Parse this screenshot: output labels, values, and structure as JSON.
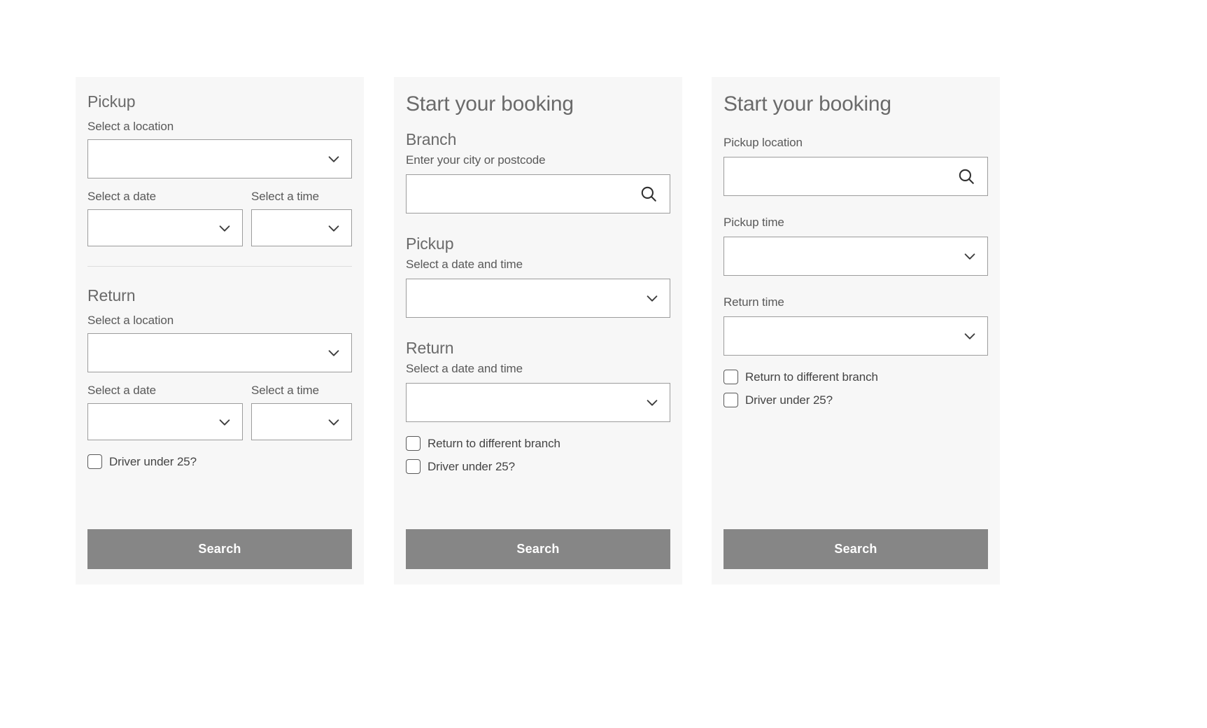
{
  "theme": {
    "page_background": "#ffffff",
    "panel_background": "#f7f7f7",
    "input_background": "#ffffff",
    "input_border": "#9c9c9c",
    "divider": "#dedede",
    "heading_text": "#6a6a6a",
    "label_text": "#595959",
    "button_background": "#868686",
    "button_text": "#ffffff"
  },
  "panels": [
    {
      "id": "panel-1",
      "variant": "pickup-return-split",
      "title": null,
      "sections": [
        {
          "heading": "Pickup",
          "location_label": "Select a location",
          "location_value": "",
          "location_placeholder": "",
          "date_label": "Select a date",
          "date_value": "",
          "date_placeholder": "",
          "time_label": "Select a time",
          "time_value": "",
          "time_placeholder": ""
        },
        {
          "heading": "Return",
          "location_label": "Select a location",
          "location_value": "",
          "location_placeholder": "",
          "date_label": "Select a date",
          "date_value": "",
          "date_placeholder": "",
          "time_label": "Select a time",
          "time_value": "",
          "time_placeholder": ""
        }
      ],
      "checkboxes": [
        {
          "label": "Driver under 25?",
          "checked": false
        }
      ],
      "submit_label": "Search",
      "icons": {
        "dropdown": "chevron-down-icon"
      }
    },
    {
      "id": "panel-2",
      "variant": "branch-search",
      "title": "Start your booking",
      "branch": {
        "heading": "Branch",
        "label": "Enter your city or postcode",
        "value": "",
        "placeholder": ""
      },
      "pickup": {
        "heading": "Pickup",
        "label": "Select a date and time",
        "value": "",
        "placeholder": ""
      },
      "return": {
        "heading": "Return",
        "label": "Select a date and time",
        "value": "",
        "placeholder": ""
      },
      "checkboxes": [
        {
          "label": "Return to different branch",
          "checked": false
        },
        {
          "label": "Driver under 25?",
          "checked": false
        }
      ],
      "submit_label": "Search",
      "icons": {
        "search": "search-icon",
        "dropdown": "chevron-down-icon"
      }
    },
    {
      "id": "panel-3",
      "variant": "compact-fields",
      "title": "Start your booking",
      "fields": [
        {
          "label": "Pickup location",
          "value": "",
          "placeholder": "",
          "control": "search"
        },
        {
          "label": "Pickup time",
          "value": "",
          "placeholder": "",
          "control": "dropdown"
        },
        {
          "label": "Return time",
          "value": "",
          "placeholder": "",
          "control": "dropdown"
        }
      ],
      "checkboxes": [
        {
          "label": "Return to different branch",
          "checked": false
        },
        {
          "label": "Driver under 25?",
          "checked": false
        }
      ],
      "submit_label": "Search",
      "icons": {
        "search": "search-icon",
        "dropdown": "chevron-down-icon"
      }
    }
  ]
}
